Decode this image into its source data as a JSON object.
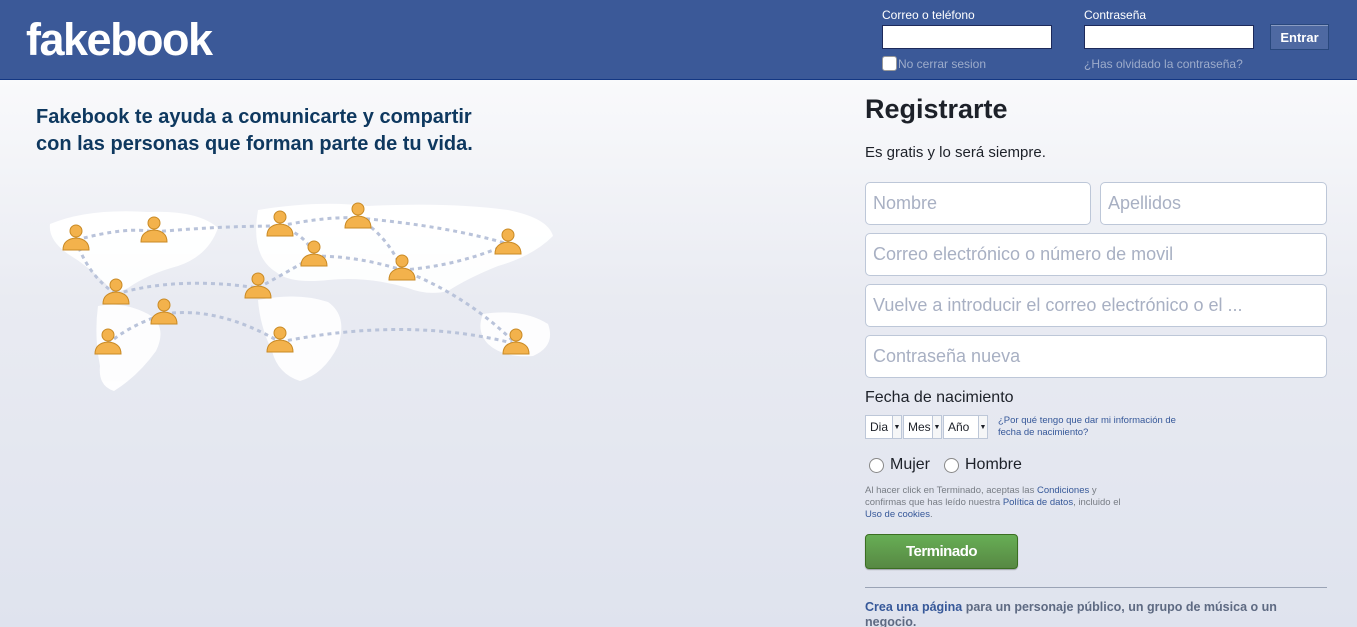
{
  "header": {
    "logo": "fakebook",
    "email_label": "Correo o teléfono",
    "password_label": "Contraseña",
    "login_button": "Entrar",
    "remember_label": "No cerrar sesion",
    "forgot_link": "¿Has olvidado la contraseña?"
  },
  "intro": {
    "tagline": "Fakebook te ayuda a comunicarte y compartir con las personas que forman parte de tu vida."
  },
  "signup": {
    "title": "Registrarte",
    "subtitle": "Es gratis y lo será siempre.",
    "first_name_placeholder": "Nombre",
    "last_name_placeholder": "Apellidos",
    "email_placeholder": "Correo electrónico o número de movil",
    "email_confirm_placeholder": "Vuelve a introducir el correo electrónico o el ...",
    "password_placeholder": "Contraseña nueva",
    "birthday_label": "Fecha de nacimiento",
    "day_select": "Dia",
    "month_select": "Mes",
    "year_select": "Año",
    "why_birthday_link": "¿Por qué tengo que dar mi información de fecha de nacimiento?",
    "gender_female": "Mujer",
    "gender_male": "Hombre",
    "terms_prefix": "Al hacer click en Terminado, aceptas las ",
    "terms_link": "Condiciones",
    "terms_middle": " y confirmas que has leído nuestra ",
    "data_policy_link": "Política de datos",
    "terms_suffix": ", incluido el ",
    "cookies_link": "Uso de cookies",
    "terms_end": ".",
    "submit_button": "Terminado",
    "create_page_link": "Crea una página",
    "create_page_text": " para un personaje público, un grupo de música o un negocio."
  },
  "colors": {
    "header_bg": "#3b5998",
    "tagline": "#0e385f",
    "submit_green": "#67ae55",
    "link": "#365899"
  },
  "icons": {
    "map": "world-map-people-icon",
    "select_arrow": "chevron-down-icon"
  }
}
